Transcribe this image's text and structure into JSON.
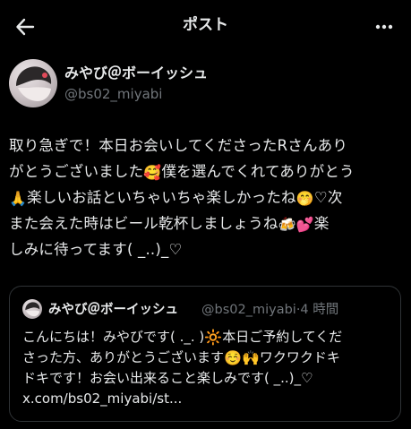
{
  "header": {
    "title": "ポスト"
  },
  "author": {
    "name": "みやび＠ボーイッシュ",
    "handle": "@bs02_miyabi"
  },
  "post": {
    "lines": [
      "取り急ぎで！本日お会いしてくださったRさんあり",
      "がとうございました",
      "僕を選んでくれてありがとう",
      "楽しいお話といちゃいちゃ楽しかったね",
      "♡次",
      "また会えた時はビール乾杯しましょうね",
      "楽",
      "しみに待ってます( _..)_♡"
    ]
  },
  "quote": {
    "name": "みやび＠ボーイッシュ",
    "handle": "@bs02_miyabi",
    "time": "4 時間",
    "lines": [
      "こんにちは！みやびです( ._. )",
      "本日ご予約してくだ",
      "さった方、ありがとうございます",
      "ワクワクドキ",
      "ドキです！お会い出来ること楽しみです( _..)_♡",
      "x.com/bs02_miyabi/st..."
    ]
  },
  "icons": {
    "back": "arrow-left-icon",
    "more": "more-dots-icon",
    "emoji_1": "smiling-face-with-hearts",
    "emoji_2": "folded-hands",
    "emoji_3": "face-with-hand-over-mouth",
    "emoji_4": "beer-mugs",
    "emoji_5": "two-hearts",
    "emoji_6": "sun",
    "emoji_7": "relieved-face",
    "emoji_8": "raising-hands"
  }
}
